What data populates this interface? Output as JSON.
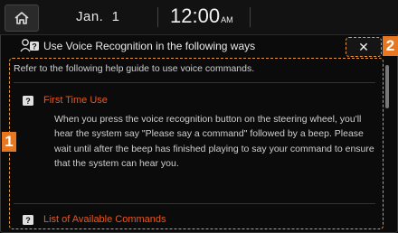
{
  "status": {
    "date": "Jan.  1",
    "time": "12:00",
    "ampm": "AM"
  },
  "header": {
    "title": "Use Voice Recognition in the following ways",
    "close_label": "✕"
  },
  "callouts": {
    "one": "1",
    "two": "2"
  },
  "content": {
    "intro": "Refer to the following help guide to use voice commands.",
    "sections": [
      {
        "title": "First Time Use",
        "body": "When you press the voice recognition button on the steering wheel, you'll hear the system say \"Please say a command\" followed by a beep. Please wait until after the beep has finished playing to say your command to ensure that the system can hear you."
      },
      {
        "title": "List of Available Commands"
      }
    ]
  },
  "colors": {
    "accent": "#e8571e",
    "callout": "#e87722"
  }
}
